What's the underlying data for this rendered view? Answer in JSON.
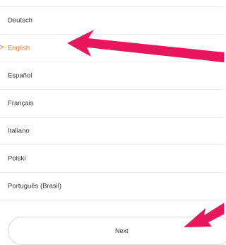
{
  "languages": [
    {
      "label": "Deutsch",
      "selected": false
    },
    {
      "label": "English",
      "selected": true
    },
    {
      "label": "Español",
      "selected": false
    },
    {
      "label": "Français",
      "selected": false
    },
    {
      "label": "Italiano",
      "selected": false
    },
    {
      "label": "Polski",
      "selected": false
    },
    {
      "label": "Português (Brasil)",
      "selected": false
    }
  ],
  "selected_marker": ">",
  "next_button": {
    "label": "Next"
  },
  "colors": {
    "accent": "#e8742a",
    "annotation_arrow": "#e8175d",
    "divider": "#ececec"
  },
  "icons": {
    "selected_marker": "chevron-right-icon",
    "annotation": "arrow-icon"
  }
}
